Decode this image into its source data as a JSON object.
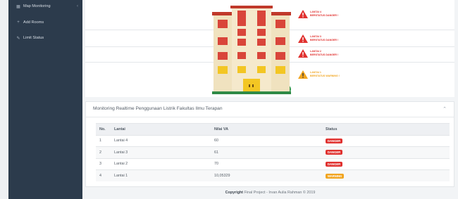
{
  "sidebar": {
    "items": [
      {
        "icon": "map-icon",
        "label": "Map Monitoring",
        "has_chevron": true
      },
      {
        "icon": "plus-icon",
        "label": "Add Rooms"
      },
      {
        "icon": "edit-icon",
        "label": "Limit Status"
      }
    ]
  },
  "alerts": [
    {
      "line1": "LANTAI 4",
      "line2": "BERSTATUS DANGER !",
      "status": "danger"
    },
    {
      "line1": "LANTAI 3",
      "line2": "BERSTATUS DANGER !",
      "status": "danger"
    },
    {
      "line1": "LANTAI 2",
      "line2": "BERSTATUS DANGER !",
      "status": "danger"
    },
    {
      "line1": "LANTAI 1",
      "line2": "BERSTATUS WARNING !",
      "status": "warning"
    }
  ],
  "panel": {
    "title": "Monitoring Realtime Penggunaan Listrik Fakultas Ilmu Terapan",
    "columns": [
      "No.",
      "Lantai",
      "Nilai VA",
      "Status"
    ],
    "rows": [
      {
        "no": "1",
        "lantai": "Lantai 4",
        "va": "60",
        "status": "DANGER",
        "status_color": "#e0312f"
      },
      {
        "no": "2",
        "lantai": "Lantai 3",
        "va": "61",
        "status": "DANGER",
        "status_color": "#e0312f"
      },
      {
        "no": "3",
        "lantai": "Lantai 2",
        "va": "70",
        "status": "DANGER",
        "status_color": "#e0312f"
      },
      {
        "no": "4",
        "lantai": "Lantai 1",
        "va": "10,05329",
        "status": "WARNING",
        "status_color": "#f1a520"
      }
    ]
  },
  "footer": {
    "bold": "Copyright",
    "text": "Final Project - Irvan Aulia Rahman © 2019"
  },
  "colors": {
    "sidebar_bg": "#2c3b4c",
    "danger": "#e0312f",
    "warning": "#f1a520"
  }
}
